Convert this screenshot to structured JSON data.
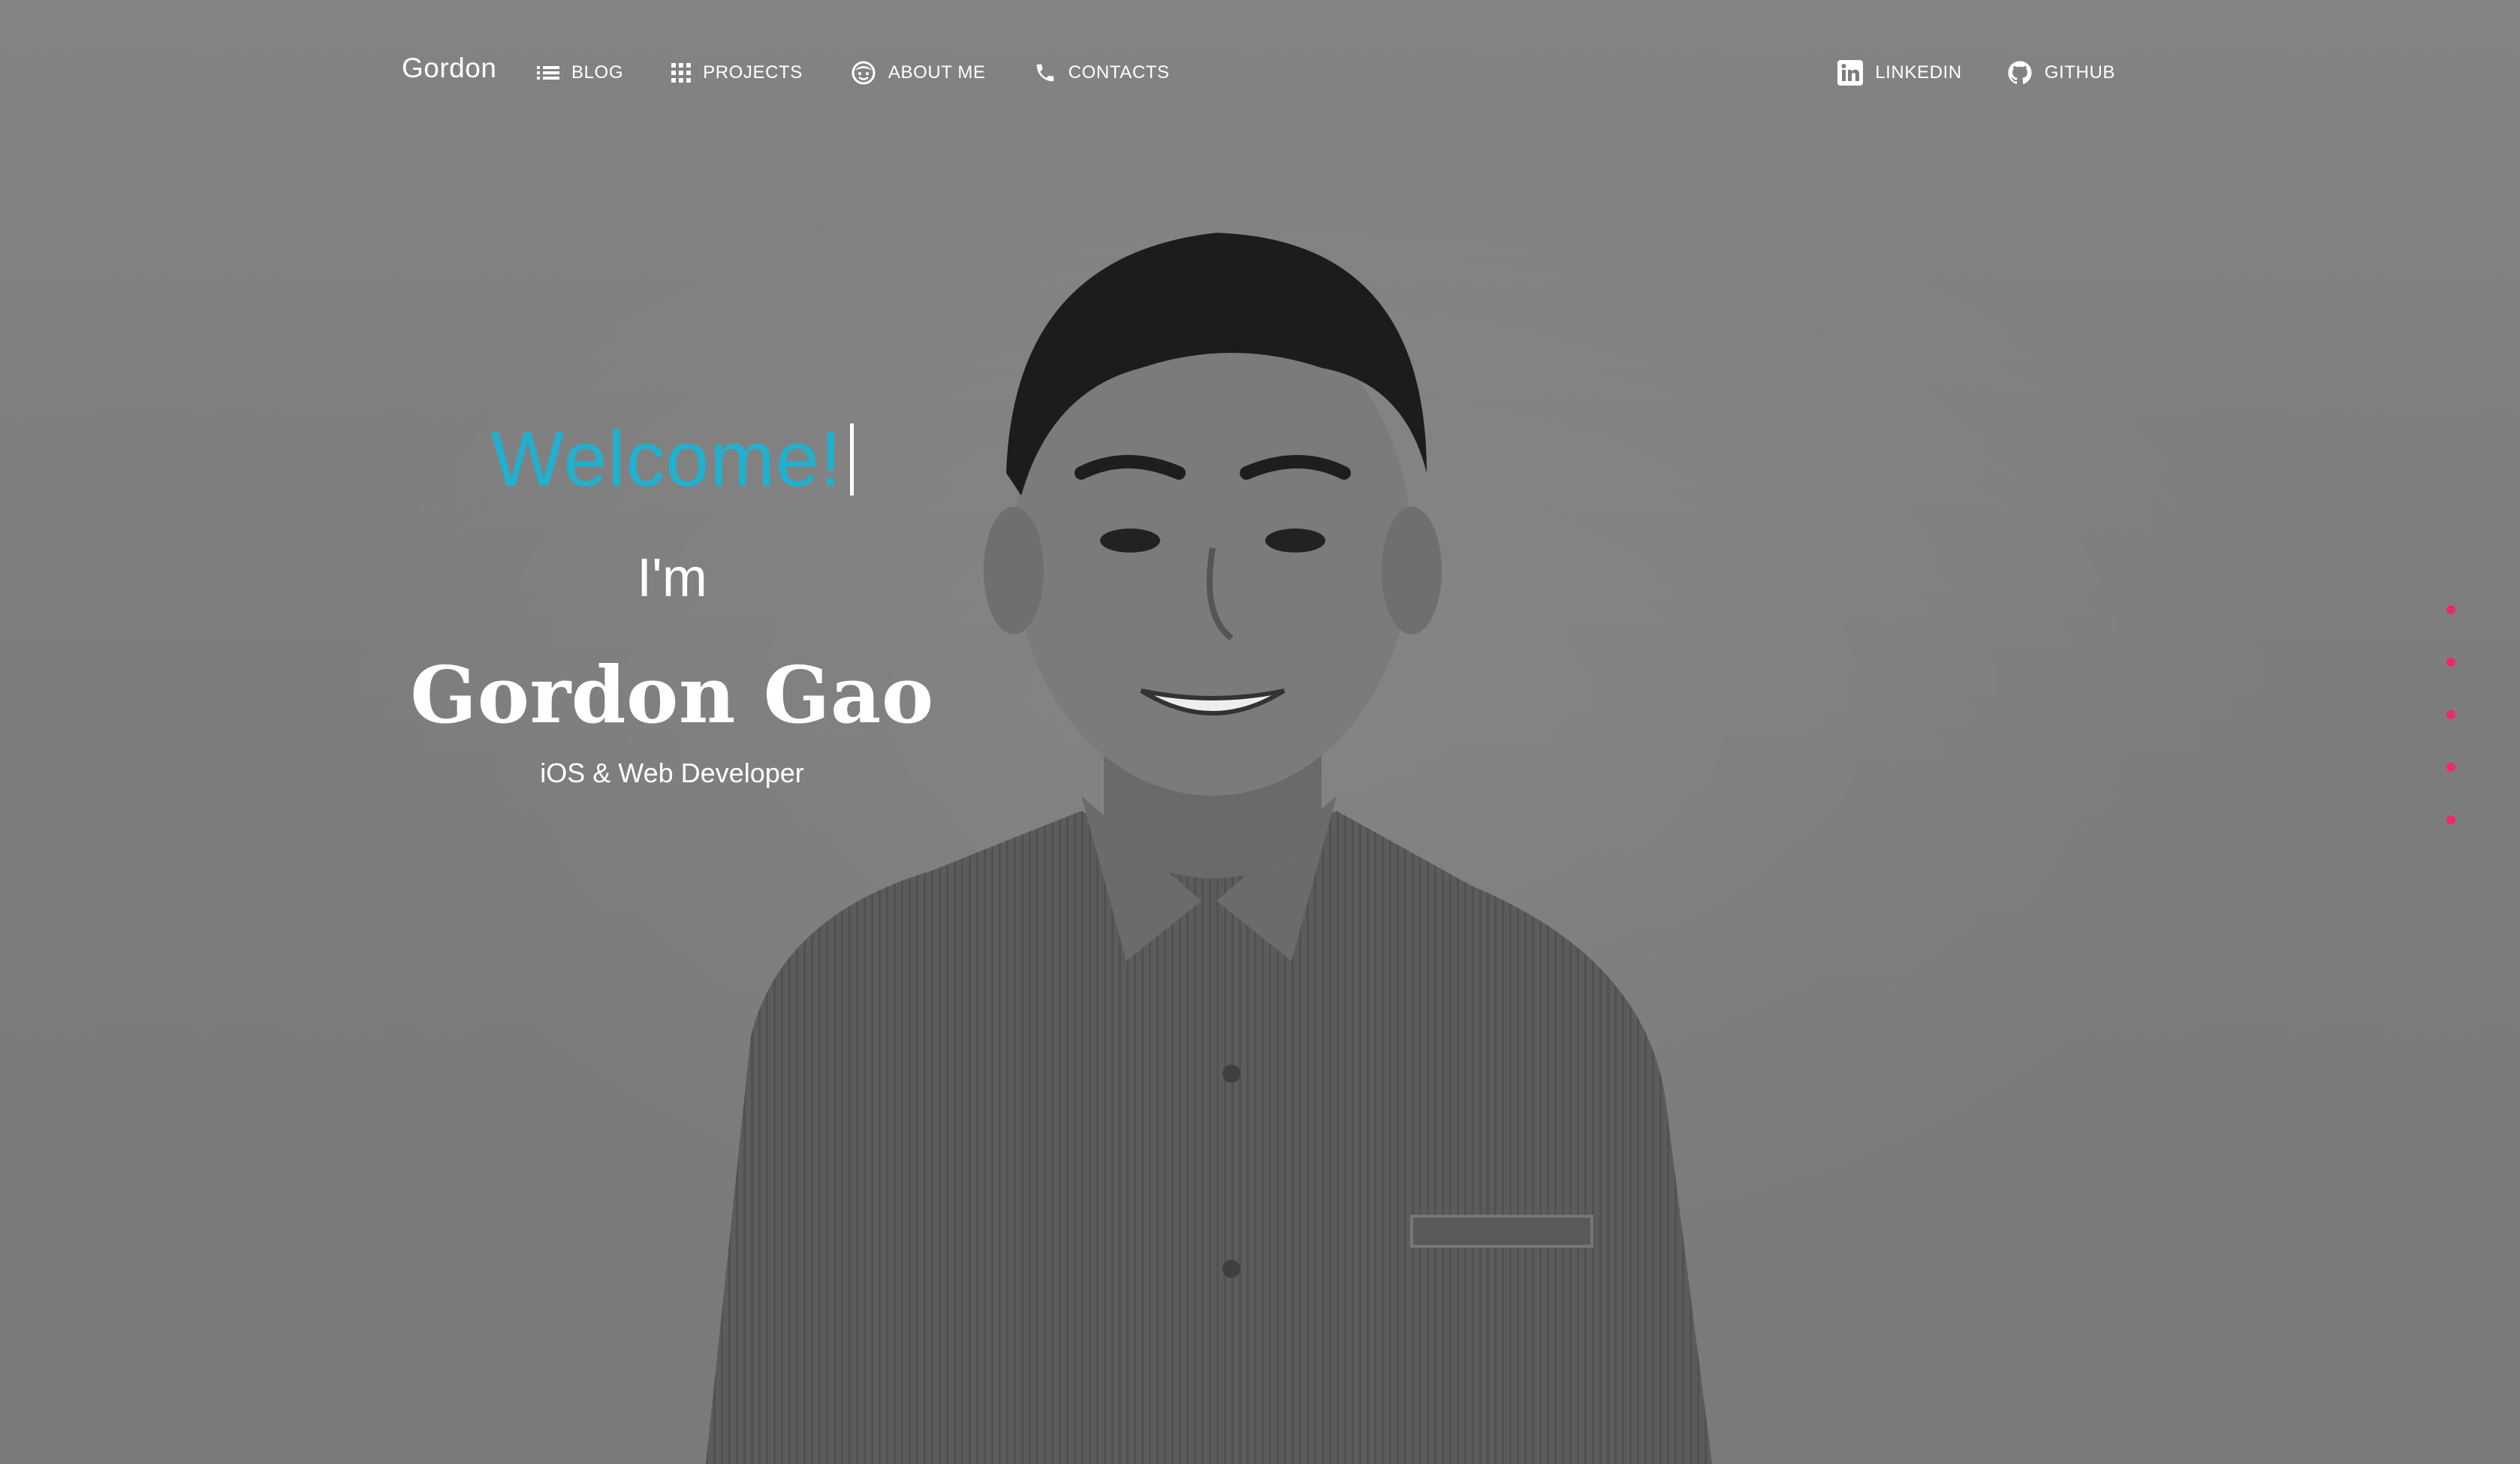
{
  "colors": {
    "accent": "#1fb1cf",
    "dot": "#f0286c",
    "text": "#ffffff",
    "background": "#7d7d7d"
  },
  "navbar": {
    "brand": "Gordon",
    "left_items": [
      {
        "label": "BLOG",
        "icon": "list-icon"
      },
      {
        "label": "PROJECTS",
        "icon": "grid-icon"
      },
      {
        "label": "ABOUT ME",
        "icon": "face-icon"
      },
      {
        "label": "CONTACTS",
        "icon": "phone-icon"
      }
    ],
    "right_items": [
      {
        "label": "LINKEDIN",
        "icon": "linkedin-icon"
      },
      {
        "label": "GITHUB",
        "icon": "github-icon"
      }
    ]
  },
  "hero": {
    "welcome": "Welcome!",
    "im": "I'm",
    "name": "Gordon Gao",
    "role": "iOS & Web Developer"
  },
  "section_dots": {
    "count": 5
  }
}
